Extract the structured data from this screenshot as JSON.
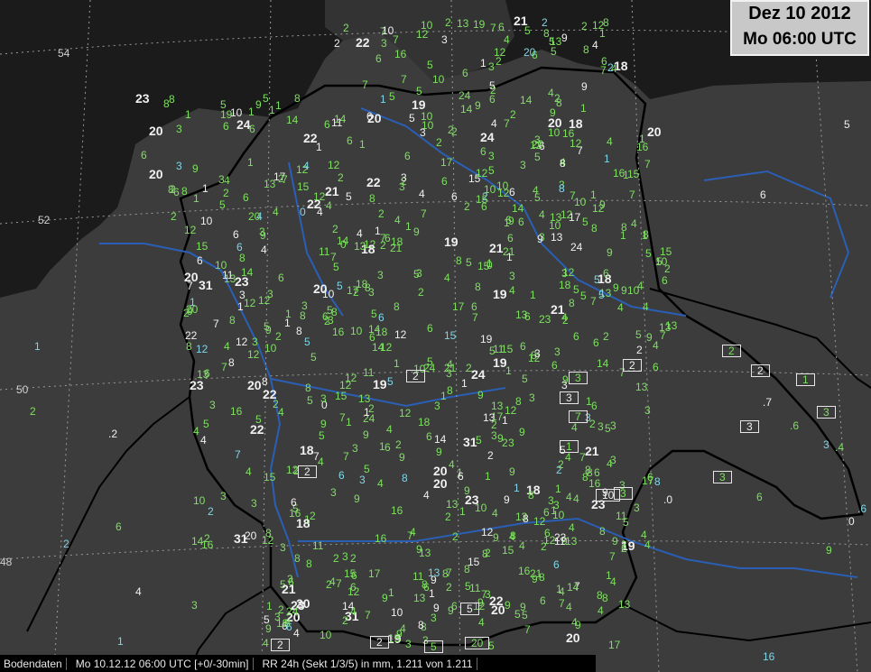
{
  "header": {
    "date": "Dez 10 2012",
    "time": "Mo 06:00 UTC"
  },
  "status_bar": {
    "source": "Bodendaten",
    "time_range": "Mo 10.12.12 06:00 UTC [+0/-30min]",
    "parameter": "RR 24h (Sekt 1/3/5) in mm, 1.211 von 1.211"
  },
  "lat_labels": [
    "54",
    "52",
    "50",
    "48"
  ],
  "colors": {
    "land": "#3c3c3c",
    "sea": "#1b1b1b",
    "border": "#000000",
    "river": "#2a5fb5",
    "green": "#7ee060",
    "white": "#f0f0f0",
    "cyan": "#7fd6e8"
  },
  "station_values": [
    "6",
    "4",
    "4",
    "2",
    "17",
    "6",
    "9",
    "21",
    "18",
    "19",
    "4",
    "5",
    "8",
    "9",
    "7",
    "5",
    "4",
    "5",
    "6",
    "4",
    "1",
    "6",
    "1",
    "12",
    "13",
    "15",
    "12",
    "13",
    "14",
    "9",
    "12",
    "8",
    "12",
    "8",
    "12",
    "10",
    "9",
    "7",
    "13",
    "19",
    "11",
    "8",
    "7",
    "8",
    "8",
    "10",
    "6",
    "9",
    "10",
    "8",
    "15",
    "7",
    "6",
    "10",
    "8",
    "8",
    "12",
    "20",
    "20",
    "15",
    "14",
    "11",
    "20",
    "21",
    "5",
    "2",
    "3",
    "2",
    "5",
    "4",
    "3",
    "23",
    "31",
    "1",
    "3",
    "16",
    "5",
    "20",
    "24",
    "24",
    "23",
    "22",
    "4",
    "22",
    "6",
    "9",
    "7",
    "4",
    "3",
    "2",
    "6",
    "5",
    "4",
    "2",
    "2",
    "1",
    "3",
    "4",
    "2",
    "1",
    "3",
    "2",
    "3",
    "3",
    "1",
    "3",
    "7",
    "6",
    "3",
    "4",
    "18",
    "18",
    "16",
    "13",
    "9",
    "5",
    "12",
    "9",
    "6",
    "7",
    "2",
    "4",
    "5",
    "1",
    "4",
    "1",
    "2",
    "6",
    "5",
    "1",
    "13",
    "2",
    "4",
    "3",
    "9",
    "8",
    "3",
    "7",
    "5",
    "3",
    "2",
    "10",
    "8",
    "6",
    "3",
    "1",
    "2",
    "1",
    "0",
    "6",
    "9",
    "1",
    "2",
    "6",
    "5",
    "16",
    "17",
    "14"
  ],
  "boxed_values": [
    "2",
    "2",
    "1",
    "2",
    "3",
    "3",
    "3",
    "2",
    "3",
    "3",
    "7",
    "2",
    "1",
    "10",
    "3",
    "5",
    "20",
    "2",
    "5",
    "2"
  ],
  "outlying_values": [
    "5",
    "2",
    "1",
    ".2",
    "6",
    "2",
    "4",
    "3",
    "1",
    "6",
    ".6",
    "3",
    ".7",
    ".4",
    "8",
    ".0",
    "6",
    ".6",
    "0",
    "9",
    "16"
  ]
}
